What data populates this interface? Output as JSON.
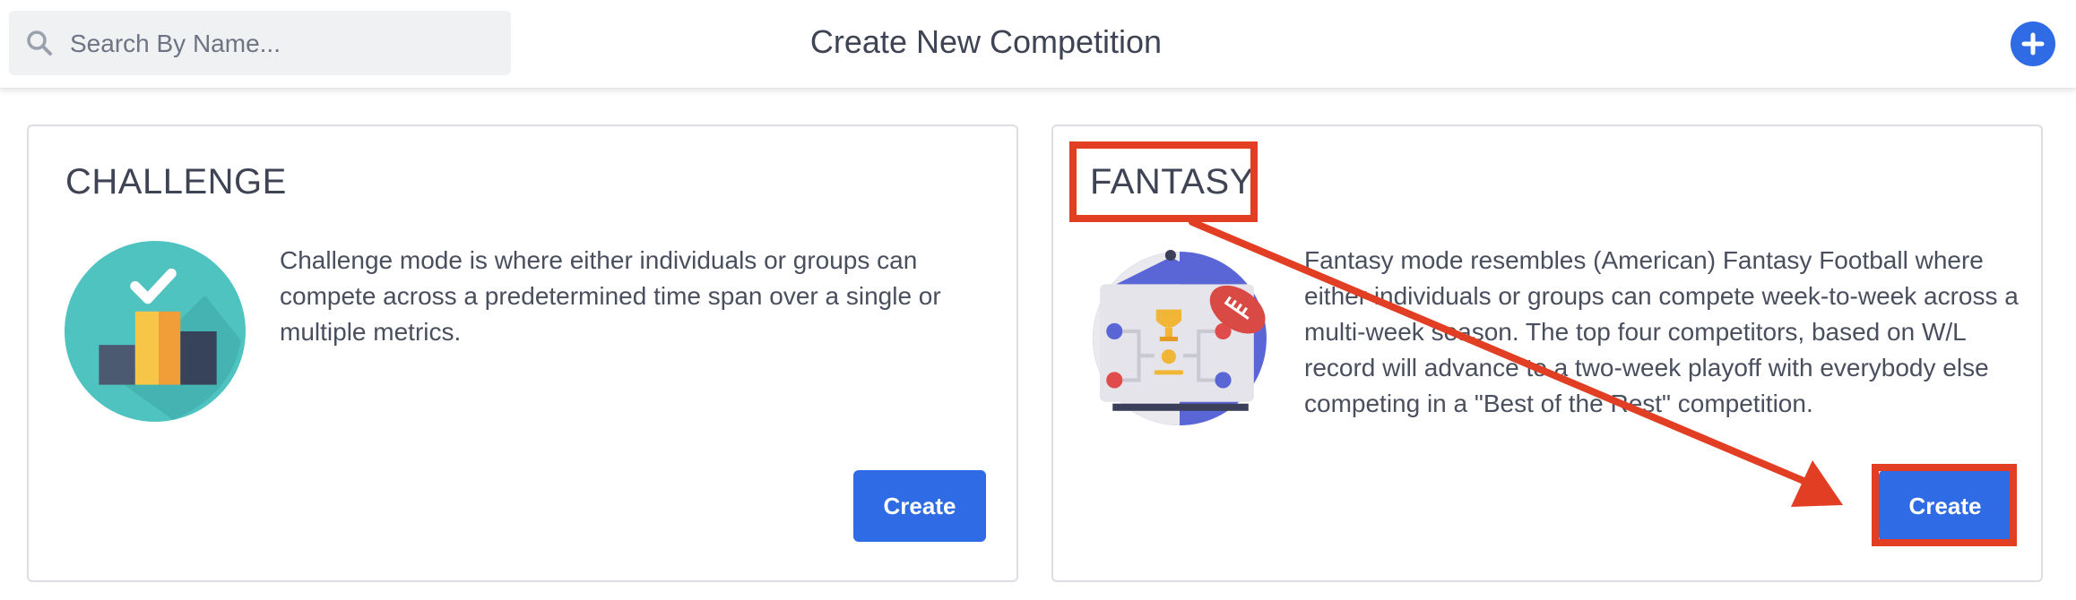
{
  "search": {
    "placeholder": "Search By Name...",
    "value": ""
  },
  "header": {
    "title": "Create New Competition",
    "add_icon": "plus-icon",
    "accent": "#2f6be4"
  },
  "cards": [
    {
      "title": "CHALLENGE",
      "description": "Challenge mode is where either individuals or groups can compete across a predetermined time span over a single or multiple metrics.",
      "button_label": "Create",
      "illustration": "podium-checkmark-icon"
    },
    {
      "title": "FANTASY",
      "description": "Fantasy mode resembles (American) Fantasy Football where either individuals or groups can compete week-to-week across a multi-week season. The top four competitors, based on W/L record will advance to a two-week playoff with everybody else competing in a \"Best of the Rest\" competition.",
      "button_label": "Create",
      "illustration": "football-bracket-trophy-icon"
    }
  ],
  "annotation": {
    "color": "#e23e23"
  }
}
